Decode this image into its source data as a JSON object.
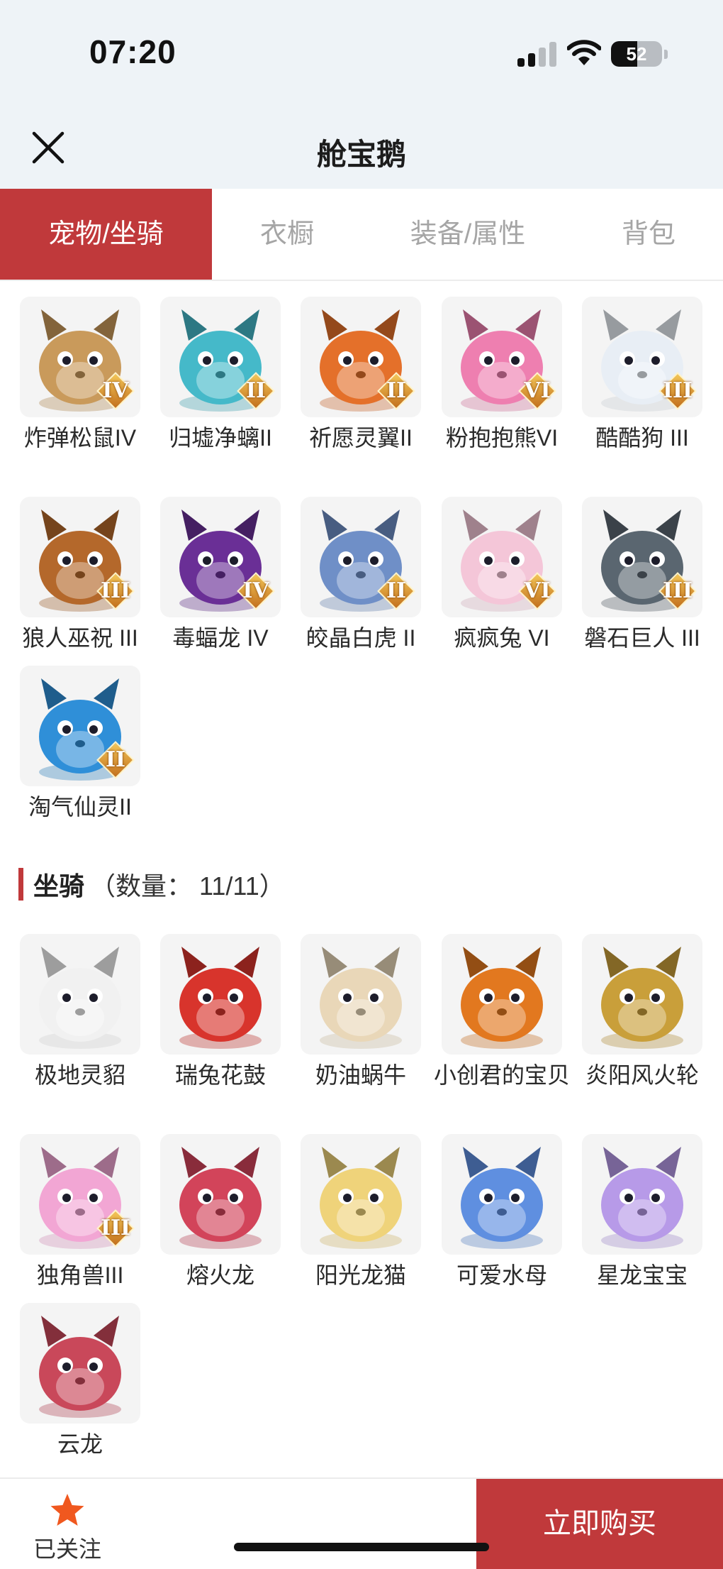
{
  "status_bar": {
    "time": "07:20",
    "battery": "52",
    "battery_level": 0.52
  },
  "header": {
    "title": "舱宝鹅"
  },
  "tabs": [
    {
      "label": "宠物/坐骑",
      "active": true
    },
    {
      "label": "衣橱",
      "active": false
    },
    {
      "label": "装备/属性",
      "active": false
    },
    {
      "label": "背包",
      "active": false
    }
  ],
  "pets": [
    {
      "name": "炸弹松鼠IV",
      "rank": "IV",
      "icon": "squirrel-icon",
      "color": "#c99a5b"
    },
    {
      "name": "归墟净螭II",
      "rank": "II",
      "icon": "water-dragon-icon",
      "color": "#45b9c9"
    },
    {
      "name": "祈愿灵翼II",
      "rank": "II",
      "icon": "phoenix-icon",
      "color": "#e4702a"
    },
    {
      "name": "粉抱抱熊VI",
      "rank": "VI",
      "icon": "pink-bear-icon",
      "color": "#ee7fb0"
    },
    {
      "name": "酷酷狗 III",
      "rank": "III",
      "icon": "cool-dog-icon",
      "color": "#e8eef5"
    },
    {
      "name": "狼人巫祝 III",
      "rank": "III",
      "icon": "werewolf-icon",
      "color": "#b4682b"
    },
    {
      "name": "毒蝠龙 IV",
      "rank": "IV",
      "icon": "bat-dragon-icon",
      "color": "#6a2f96"
    },
    {
      "name": "皎晶白虎 II",
      "rank": "II",
      "icon": "white-tiger-icon",
      "color": "#6f8fc7"
    },
    {
      "name": "疯疯兔 VI",
      "rank": "VI",
      "icon": "crazy-rabbit-icon",
      "color": "#f4c6d8"
    },
    {
      "name": "磐石巨人 III",
      "rank": "III",
      "icon": "rock-giant-icon",
      "color": "#5a6670"
    },
    {
      "name": "淘气仙灵II",
      "rank": "II",
      "icon": "blue-sprite-icon",
      "color": "#2f8fd8"
    }
  ],
  "mounts_section": {
    "title": "坐骑",
    "count_label": "（数量： 11/11）"
  },
  "mounts": [
    {
      "name": "极地灵貂",
      "icon": "polar-ferret-icon",
      "color": "#f1f1f1"
    },
    {
      "name": "瑞兔花鼓",
      "icon": "rabbit-drum-icon",
      "color": "#d8342c"
    },
    {
      "name": "奶油蜗牛",
      "icon": "cream-snail-icon",
      "color": "#e9d7b8"
    },
    {
      "name": "小创君的宝贝",
      "icon": "colorful-bird-icon",
      "color": "#e2781f"
    },
    {
      "name": "炎阳风火轮",
      "icon": "fire-wheel-icon",
      "color": "#c99f3a"
    },
    {
      "name": "独角兽III",
      "rank": "III",
      "icon": "unicorn-icon",
      "color": "#f2a6d4"
    },
    {
      "name": "熔火龙",
      "icon": "lava-dragon-icon",
      "color": "#d2445a"
    },
    {
      "name": "阳光龙猫",
      "icon": "sunny-cat-icon",
      "color": "#efd37a"
    },
    {
      "name": "可爱水母",
      "icon": "jellyfish-icon",
      "color": "#5f8fe0"
    },
    {
      "name": "星龙宝宝",
      "icon": "star-dragon-icon",
      "color": "#b79ae8"
    },
    {
      "name": "云龙",
      "icon": "cloud-dragon-icon",
      "color": "#c9485a"
    }
  ],
  "bottom_bar": {
    "follow_label": "已关注",
    "buy_label": "立即购买",
    "accent": "#c0393b",
    "star_color": "#f0581f"
  }
}
